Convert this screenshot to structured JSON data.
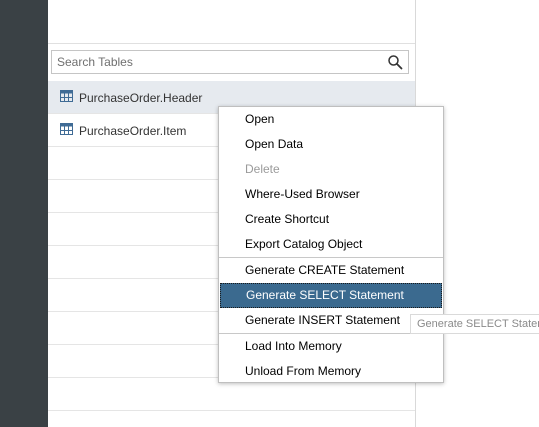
{
  "search": {
    "placeholder": "Search Tables",
    "value": ""
  },
  "tables": [
    {
      "label": "PurchaseOrder.Header",
      "icon": "table-icon",
      "selected": true
    },
    {
      "label": "PurchaseOrder.Item",
      "icon": "table-icon",
      "selected": false
    }
  ],
  "context_menu": {
    "items": [
      {
        "label": "Open",
        "disabled": false
      },
      {
        "label": "Open Data",
        "disabled": false
      },
      {
        "label": "Delete",
        "disabled": true
      },
      {
        "label": "Where-Used Browser",
        "disabled": false
      },
      {
        "label": "Create Shortcut",
        "disabled": false
      },
      {
        "label": "Export Catalog Object",
        "disabled": false
      },
      {
        "label": "Generate CREATE Statement",
        "disabled": false
      },
      {
        "label": "Generate SELECT Statement",
        "disabled": false,
        "hovered": true
      },
      {
        "label": "Generate INSERT Statement",
        "disabled": false
      },
      {
        "label": "Load Into Memory",
        "disabled": false
      },
      {
        "label": "Unload From Memory",
        "disabled": false
      }
    ]
  },
  "tooltip": {
    "text": "Generate SELECT Statement"
  },
  "colors": {
    "rail": "#3a4145",
    "selected_row": "#e6eaef",
    "menu_hover": "#3b6a8f",
    "icon_blue": "#3f6b95"
  }
}
